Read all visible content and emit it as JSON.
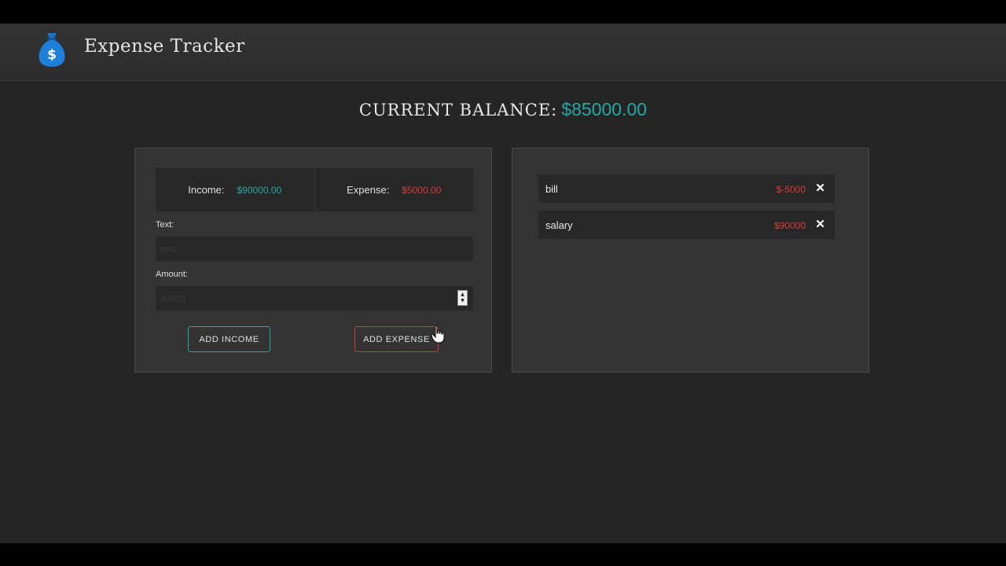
{
  "header": {
    "title": "Expense Tracker",
    "logo_icon": "money-bag-icon"
  },
  "balance": {
    "label": "CURRENT BALANCE:",
    "value": "$85000.00"
  },
  "summary": {
    "income_label": "Income:",
    "income_value": "$90000.00",
    "expense_label": "Expense:",
    "expense_value": "$5000.00"
  },
  "form": {
    "text_label": "Text:",
    "text_value": "rent",
    "amount_label": "Amount:",
    "amount_value": "40000",
    "add_income_label": "ADD INCOME",
    "add_expense_label": "ADD EXPENSE"
  },
  "transactions": [
    {
      "text": "bill",
      "amount": "$-5000",
      "delete": "✕"
    },
    {
      "text": "salary",
      "amount": "$90000",
      "delete": "✕"
    }
  ],
  "colors": {
    "income": "#23a8a2",
    "expense": "#d63c3c",
    "background": "#252525"
  }
}
